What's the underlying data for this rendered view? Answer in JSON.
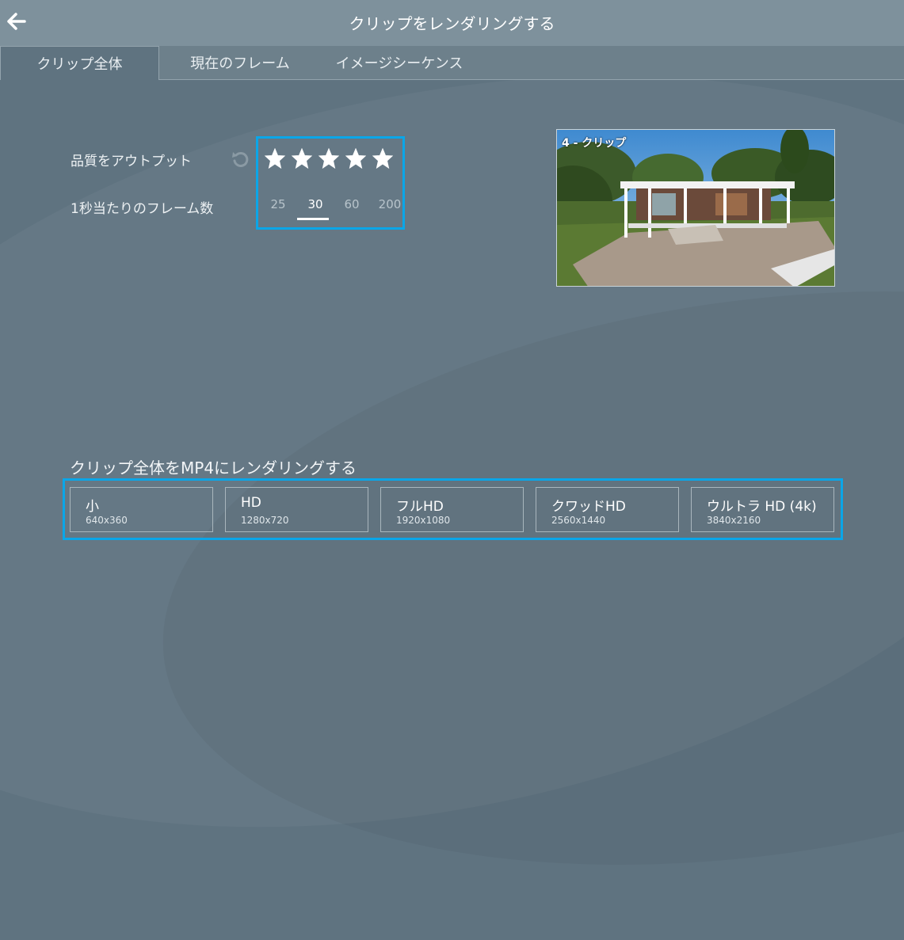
{
  "window": {
    "title": "クリップをレンダリングする"
  },
  "tabs": [
    {
      "label": "クリップ全体",
      "active": true
    },
    {
      "label": "現在のフレーム",
      "active": false
    },
    {
      "label": "イメージシーケンス",
      "active": false
    }
  ],
  "settings": {
    "quality_label": "品質をアウトプット",
    "quality_stars": 5,
    "quality_max": 5,
    "fps_label": "1秒当たりのフレーム数",
    "fps_options": [
      "25",
      "30",
      "60",
      "200"
    ],
    "fps_selected": "30"
  },
  "preview": {
    "label": "4 - クリップ"
  },
  "render": {
    "title": "クリップ全体をMP4にレンダリングする",
    "options": [
      {
        "name": "小",
        "size": "640x360"
      },
      {
        "name": "HD",
        "size": "1280x720"
      },
      {
        "name": "フルHD",
        "size": "1920x1080"
      },
      {
        "name": "クワッドHD",
        "size": "2560x1440"
      },
      {
        "name": "ウルトラ HD (4k)",
        "size": "3840x2160"
      }
    ]
  },
  "colors": {
    "highlight": "#0aa6e8",
    "background": "#5f7380",
    "titlebar": "#7e919c"
  },
  "icons": {
    "back": "arrow-left-icon",
    "reset": "undo-icon",
    "star": "star-icon"
  }
}
